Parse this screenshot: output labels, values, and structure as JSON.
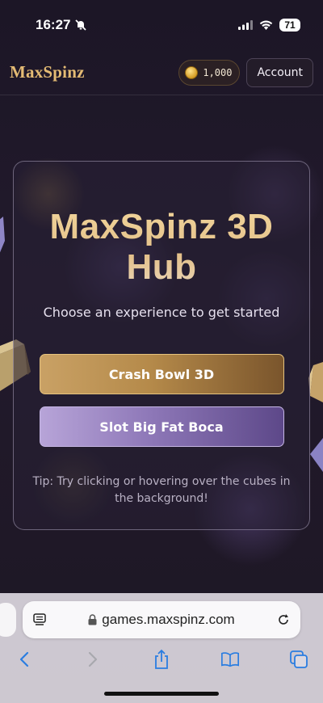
{
  "status_bar": {
    "time": "16:27",
    "battery": "71",
    "icons": [
      "bell-slash-icon",
      "signal-icon",
      "wifi-icon",
      "battery-icon"
    ]
  },
  "header": {
    "brand": "MaxSpinz",
    "balance": "1,000",
    "account_label": "Account"
  },
  "hub": {
    "title": "MaxSpinz 3D Hub",
    "subtitle": "Choose an experience to get started",
    "buttons": [
      {
        "label": "Crash Bowl 3D"
      },
      {
        "label": "Slot Big Fat Boca"
      }
    ],
    "tip": "Tip: Try clicking or hovering over the cubes in the background!"
  },
  "browser": {
    "url": "games.maxspinz.com",
    "toolbar_icons": [
      "back-icon",
      "forward-icon",
      "share-icon",
      "bookmarks-icon",
      "tabs-icon"
    ]
  },
  "colors": {
    "brand_gold": "#e4bb74",
    "background": "#1a1420",
    "crash_button": "#b58a4a",
    "slot_button": "#8e78b8"
  }
}
